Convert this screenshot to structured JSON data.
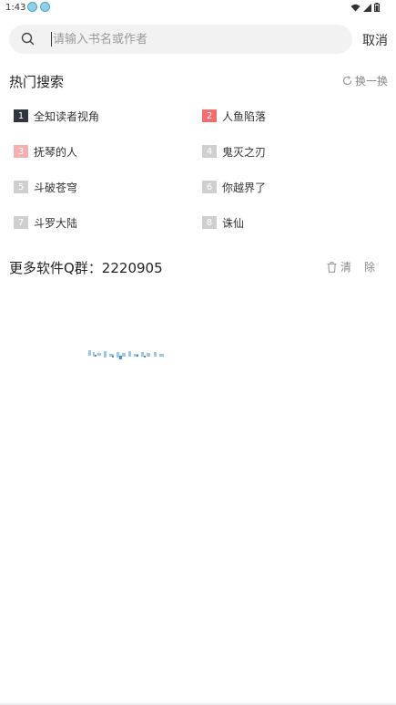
{
  "status_bar": {
    "time": "1:43",
    "notification_icons": [
      "app-notification-icon",
      "app-notification-icon"
    ],
    "system_icons": [
      "wifi-icon",
      "signal-icon",
      "battery-icon"
    ]
  },
  "search": {
    "placeholder": "请输入书名或作者",
    "value": "",
    "cancel_label": "取消"
  },
  "hot_search": {
    "title": "热门搜索",
    "refresh_label": "换一换",
    "items": [
      {
        "rank": "1",
        "name": "全知读者视角",
        "badge_color": "#2f3640"
      },
      {
        "rank": "2",
        "name": "人鱼陷落",
        "badge_color": "#f26d6d"
      },
      {
        "rank": "3",
        "name": "抚琴的人",
        "badge_color": "#f7aeb0"
      },
      {
        "rank": "4",
        "name": "鬼灭之刃",
        "badge_color": "#cfcfcf"
      },
      {
        "rank": "5",
        "name": "斗破苍穹",
        "badge_color": "#cfcfcf"
      },
      {
        "rank": "6",
        "name": "你越界了",
        "badge_color": "#cfcfcf"
      },
      {
        "rank": "7",
        "name": "斗罗大陆",
        "badge_color": "#cfcfcf"
      },
      {
        "rank": "8",
        "name": "诛仙",
        "badge_color": "#cfcfcf"
      }
    ]
  },
  "history": {
    "title": "更多软件Q群：2220905",
    "clear_label": "清除"
  }
}
